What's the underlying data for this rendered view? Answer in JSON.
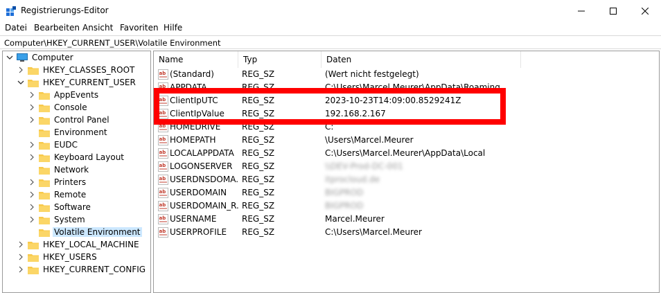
{
  "window": {
    "title": "Registrierungs-Editor"
  },
  "menu": [
    "Datei",
    "Bearbeiten",
    "Ansicht",
    "Favoriten",
    "Hilfe"
  ],
  "address": "Computer\\HKEY_CURRENT_USER\\Volatile Environment",
  "tree": {
    "root": "Computer",
    "hives": [
      "HKEY_CLASSES_ROOT",
      "HKEY_CURRENT_USER",
      "HKEY_LOCAL_MACHINE",
      "HKEY_USERS",
      "HKEY_CURRENT_CONFIG"
    ],
    "hkcu_children": [
      "AppEvents",
      "Console",
      "Control Panel",
      "Environment",
      "EUDC",
      "Keyboard Layout",
      "Network",
      "Printers",
      "Remote",
      "Software",
      "System",
      "Volatile Environment"
    ],
    "selected": "Volatile Environment"
  },
  "columns": [
    "Name",
    "Typ",
    "Daten"
  ],
  "values": [
    {
      "name": "(Standard)",
      "type": "REG_SZ",
      "data": "(Wert nicht festgelegt)"
    },
    {
      "name": "APPDATA",
      "type": "REG_SZ",
      "data": "C:\\Users\\Marcel.Meurer\\AppData\\Roaming"
    },
    {
      "name": "ClientIpUTC",
      "type": "REG_SZ",
      "data": "2023-10-23T14:09:00.8529241Z"
    },
    {
      "name": "ClientIpValue",
      "type": "REG_SZ",
      "data": "192.168.2.167"
    },
    {
      "name": "HOMEDRIVE",
      "type": "REG_SZ",
      "data": "C:"
    },
    {
      "name": "HOMEPATH",
      "type": "REG_SZ",
      "data": "\\Users\\Marcel.Meurer"
    },
    {
      "name": "LOCALAPPDATA",
      "type": "REG_SZ",
      "data": "C:\\Users\\Marcel.Meurer\\AppData\\Local"
    },
    {
      "name": "LOGONSERVER",
      "type": "REG_SZ",
      "data": "\\\\DEV-Prod-DC-001"
    },
    {
      "name": "USERDNSDOMA...",
      "type": "REG_SZ",
      "data": "itprocloud.de"
    },
    {
      "name": "USERDOMAIN",
      "type": "REG_SZ",
      "data": "BIGPROD"
    },
    {
      "name": "USERDOMAIN_R...",
      "type": "REG_SZ",
      "data": "BIGPROD"
    },
    {
      "name": "USERNAME",
      "type": "REG_SZ",
      "data": "Marcel.Meurer"
    },
    {
      "name": "USERPROFILE",
      "type": "REG_SZ",
      "data": "C:\\Users\\Marcel.Meurer"
    }
  ],
  "colors": {
    "highlight": "#ff0000",
    "selection": "#cce8ff",
    "folder": "#f8c94a"
  }
}
